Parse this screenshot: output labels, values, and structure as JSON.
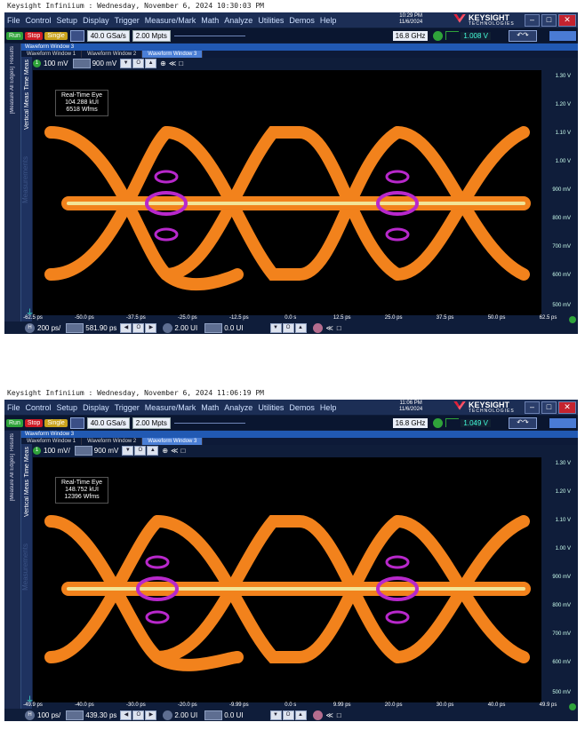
{
  "colors": {
    "accent": "#2159b3",
    "run": "#2fa33a",
    "stop": "#d11c26",
    "single": "#c9a21b",
    "trigger": "#2fa33a",
    "eye_hot": "#fff1a0",
    "eye_mid": "#ff8a1e",
    "eye_cool": "#c22bd6",
    "eye_edge": "#1fd14a"
  },
  "menu": [
    "File",
    "Control",
    "Setup",
    "Display",
    "Trigger",
    "Measure/Mark",
    "Math",
    "Analyze",
    "Utilities",
    "Demos",
    "Help"
  ],
  "brand": {
    "name": "KEYSIGHT",
    "sub": "TECHNOLOGIES"
  },
  "window": {
    "title": "Waveform Window 3",
    "tabs": [
      "Waveform Window 1",
      "Waveform Window 2",
      "Waveform Window 3"
    ]
  },
  "rail": {
    "left_tab": "Results",
    "left_tab2": "[Measure All Edges]",
    "meas_tabs": [
      "Time Meas",
      "Vertical Meas"
    ],
    "ghost": "Measurements"
  },
  "toolbar": {
    "run": "Run",
    "stop": "Stop",
    "single": "Single",
    "sample_rate": "40.0 GSa/s",
    "memory": "2.00 Mpts",
    "bandwidth": "16.8 GHz"
  },
  "y_ticks": [
    "1.30 V",
    "1.20 V",
    "1.10 V",
    "1.00 V",
    "900 mV",
    "800 mV",
    "700 mV",
    "600 mV",
    "500 mV"
  ],
  "shots": [
    {
      "caption": "Keysight Infiniium : Wednesday, November 6, 2024 10:30:03 PM",
      "clock": [
        "10:29 PM",
        "11/6/2024"
      ],
      "trigger_level": "1.008 V",
      "vscale": "100 mV",
      "voffset": "900 mV",
      "info": [
        "Real-Time Eye",
        "104.288 kUI",
        "6518 Wfms"
      ],
      "x_ticks": [
        "-62.5 ps",
        "-50.0 ps",
        "-37.5 ps",
        "-25.0 ps",
        "-12.5 ps",
        "0.0 s",
        "12.5 ps",
        "25.0 ps",
        "37.5 ps",
        "50.0 ps",
        "62.5 ps"
      ],
      "hscale": "200 ps/",
      "hpos": "581.90 ps",
      "ui_a": "2.00 UI",
      "ui_b": "0.0 UI"
    },
    {
      "caption": "Keysight Infiniium : Wednesday, November 6, 2024 11:06:19 PM",
      "clock": [
        "11:06 PM",
        "11/6/2024"
      ],
      "trigger_level": "1.049 V",
      "vscale": "100 mV/",
      "voffset": "900 mV",
      "info": [
        "Real-Time Eye",
        "148.752 kUI",
        "12396 Wfms"
      ],
      "x_ticks": [
        "-49.9 ps",
        "-40.0 ps",
        "-30.0 ps",
        "-20.0 ps",
        "-9.99 ps",
        "0.0 s",
        "9.99 ps",
        "20.0 ps",
        "30.0 ps",
        "40.0 ps",
        "49.9 ps"
      ],
      "hscale": "100 ps/",
      "hpos": "439.30 ps",
      "ui_a": "2.00 UI",
      "ui_b": "0.0 UI"
    }
  ]
}
